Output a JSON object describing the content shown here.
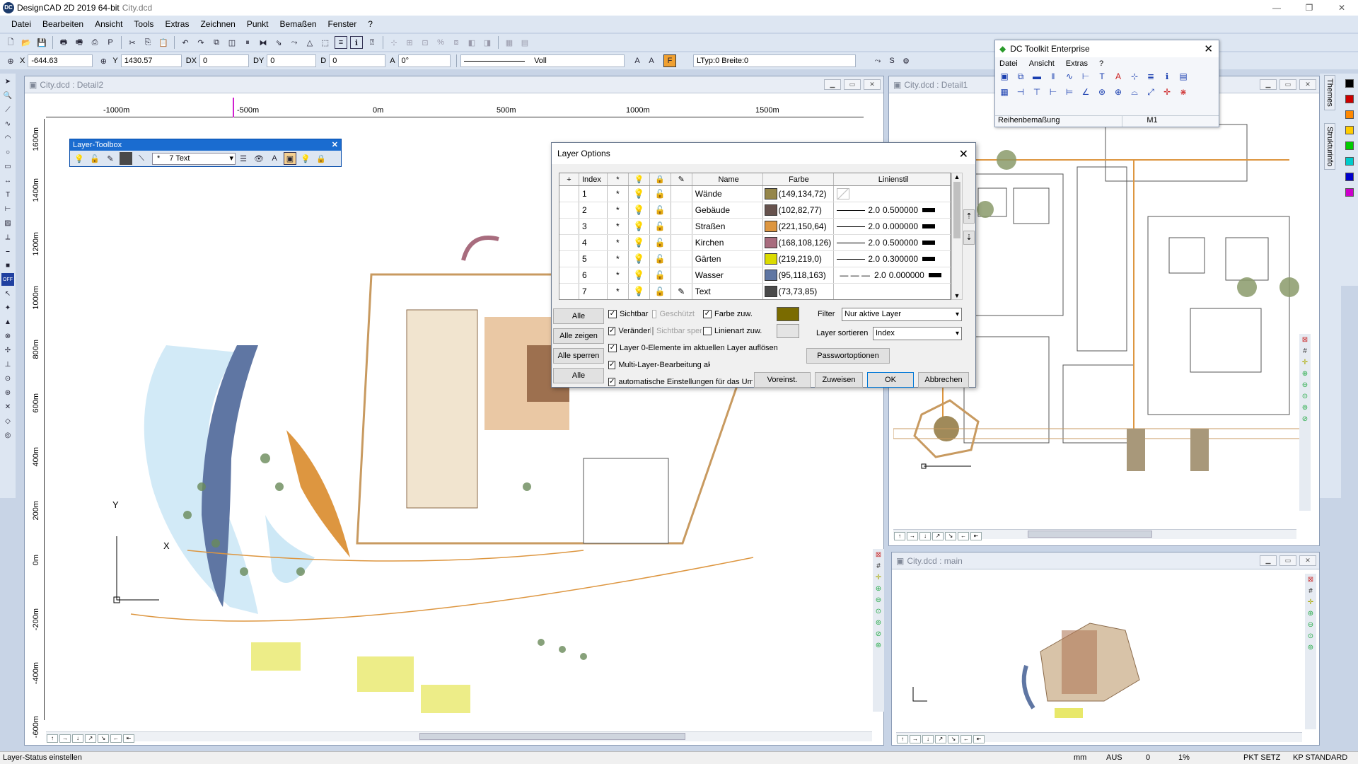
{
  "app": {
    "title": "DesignCAD 2D 2019 64-bit",
    "file": "City.dcd"
  },
  "menu": [
    "Datei",
    "Bearbeiten",
    "Ansicht",
    "Tools",
    "Extras",
    "Zeichnen",
    "Punkt",
    "Bemaßen",
    "Fenster",
    "?"
  ],
  "coords": {
    "x_label": "X",
    "x": "-644.63",
    "y_label": "Y",
    "y": "1430.57",
    "dx_label": "DX",
    "dx": "0",
    "dy_label": "DY",
    "dy": "0",
    "d_label": "D",
    "d": "0",
    "a_label": "A",
    "a": "0°",
    "linestyle": "Voll",
    "ltyp": "LTyp:0  Breite:0"
  },
  "windows": {
    "detail2": {
      "title": "City.dcd : Detail2",
      "ruler_x": [
        "-1000m",
        "-500m",
        "0m",
        "500m",
        "1000m",
        "1500m"
      ],
      "ruler_y": [
        "1600m",
        "1400m",
        "1200m",
        "1000m",
        "800m",
        "600m",
        "400m",
        "200m",
        "0m",
        "-200m",
        "-400m",
        "-600m"
      ]
    },
    "detail1": {
      "title": "City.dcd : Detail1"
    },
    "main": {
      "title": "City.dcd : main"
    }
  },
  "layer_toolbox": {
    "title": "Layer-Toolbox",
    "current": "7  Text",
    "star": "*"
  },
  "dc_toolkit": {
    "title": "DC Toolkit Enterprise",
    "menu": [
      "Datei",
      "Ansicht",
      "Extras",
      "?"
    ],
    "status_left": "Reihenbemaßung",
    "status_right": "M1"
  },
  "layer_options": {
    "title": "Layer Options",
    "columns": [
      "+",
      "Index",
      "*",
      "💡",
      "🔒",
      "✎",
      "Name",
      "Farbe",
      "Linienstil"
    ],
    "rows": [
      {
        "index": "1",
        "star": "*",
        "name": "Wände",
        "color": "#95864a",
        "color_text": "(149,134,72)",
        "style": "",
        "width": ""
      },
      {
        "index": "2",
        "star": "*",
        "name": "Gebäude",
        "color": "#66524d",
        "color_text": "(102,82,77)",
        "style": "2.0",
        "width": "0.500000"
      },
      {
        "index": "3",
        "star": "*",
        "name": "Straßen",
        "color": "#dd9640",
        "color_text": "(221,150,64)",
        "style": "2.0",
        "width": "0.000000"
      },
      {
        "index": "4",
        "star": "*",
        "name": "Kirchen",
        "color": "#a86c7e",
        "color_text": "(168,108,126)",
        "style": "2.0",
        "width": "0.500000"
      },
      {
        "index": "5",
        "star": "*",
        "name": "Gärten",
        "color": "#dbdb00",
        "color_text": "(219,219,0)",
        "style": "2.0",
        "width": "0.300000"
      },
      {
        "index": "6",
        "star": "*",
        "name": "Wasser",
        "color": "#5f76a3",
        "color_text": "(95,118,163)",
        "style": "2.0",
        "width": "0.000000"
      },
      {
        "index": "7",
        "star": "*",
        "name": "Text",
        "color": "#494949",
        "color_text": "(73,73,85)",
        "style": "",
        "width": ""
      }
    ],
    "buttons_left": [
      "Alle verstecken",
      "Alle zeigen",
      "Alle sperren",
      "Alle entsperren"
    ],
    "checks": {
      "sichtbar": "Sichtbar",
      "geschuetzt": "Geschützt",
      "farbe_zuw": "Farbe zuw.",
      "veraender": "Veränderbar",
      "sichtbar_sp": "Sichtbar sperren",
      "linienart_zuw": "Linienart zuw.",
      "layer0": "Layer 0-Elemente im aktuellen Layer auflösen",
      "multi": "Multi-Layer-Bearbeitung aktivieren",
      "auto": "automatische Einstellungen für das Umschalten"
    },
    "filter_label": "Filter",
    "filter_value": "Nur aktive Layer",
    "sort_label": "Layer sortieren",
    "sort_value": "Index",
    "password": "Passwortoptionen",
    "btn_default": "Voreinst. speichern",
    "btn_assign": "Zuweisen",
    "btn_ok": "OK",
    "btn_cancel": "Abbrechen",
    "swatch_color": "#7a6b00"
  },
  "side_tabs": [
    "Themes",
    "Strukturinfo"
  ],
  "palette": [
    "#000000",
    "#cc0000",
    "#ff8800",
    "#ffcc00",
    "#00cc00",
    "#00cccc",
    "#0000cc",
    "#cc00cc"
  ],
  "status": {
    "left": "Layer-Status einstellen",
    "mm": "mm",
    "aus": "AUS",
    "zero": "0",
    "pct": "1%",
    "pkt": "PKT SETZ",
    "kp": "KP STANDARD"
  }
}
